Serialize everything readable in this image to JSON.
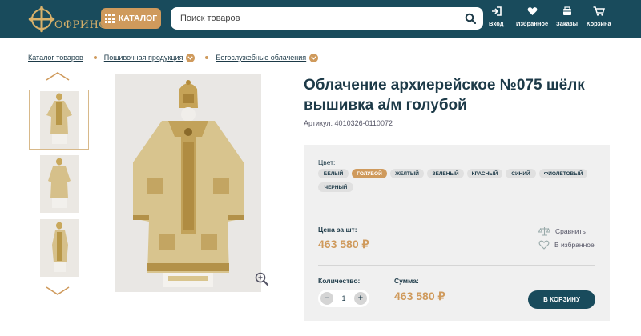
{
  "header": {
    "logo_text": "ОФРИНО",
    "catalog_label": "КАТАЛОГ",
    "search_placeholder": "Поиск товаров",
    "actions": [
      {
        "label": "Вход",
        "icon": "login-icon"
      },
      {
        "label": "Избранное",
        "icon": "heart-icon"
      },
      {
        "label": "Заказы",
        "icon": "orders-icon"
      },
      {
        "label": "Корзина",
        "icon": "cart-icon"
      }
    ]
  },
  "breadcrumb": [
    "Каталог товаров",
    "Пошивочная продукция",
    "Богослужебные облачения"
  ],
  "product": {
    "title": "Облачение архиерейское №075 шёлк вышивка а/м голубой",
    "sku": "Артикул: 4010326-0110072",
    "color_label": "Цвет:",
    "colors": [
      "БЕЛЫЙ",
      "ГОЛУБОЙ",
      "ЖЕЛТЫЙ",
      "ЗЕЛЕНЫЙ",
      "КРАСНЫЙ",
      "СИНИЙ",
      "ФИОЛЕТОВЫЙ",
      "ЧЕРНЫЙ"
    ],
    "selected_color": "ГОЛУБОЙ",
    "price_label": "Цена за шт:",
    "price": "463 580 ₽",
    "compare_label": "Сравнить",
    "favorite_label": "В избранное",
    "quantity_label": "Количество:",
    "quantity": "1",
    "sum_label": "Сумма:",
    "sum": "463 580 ₽",
    "cart_button": "В КОРЗИНУ"
  },
  "colors": {
    "header_bg": "#194b5c",
    "accent": "#cf9a5c",
    "panel_bg": "#f0f0f0"
  }
}
